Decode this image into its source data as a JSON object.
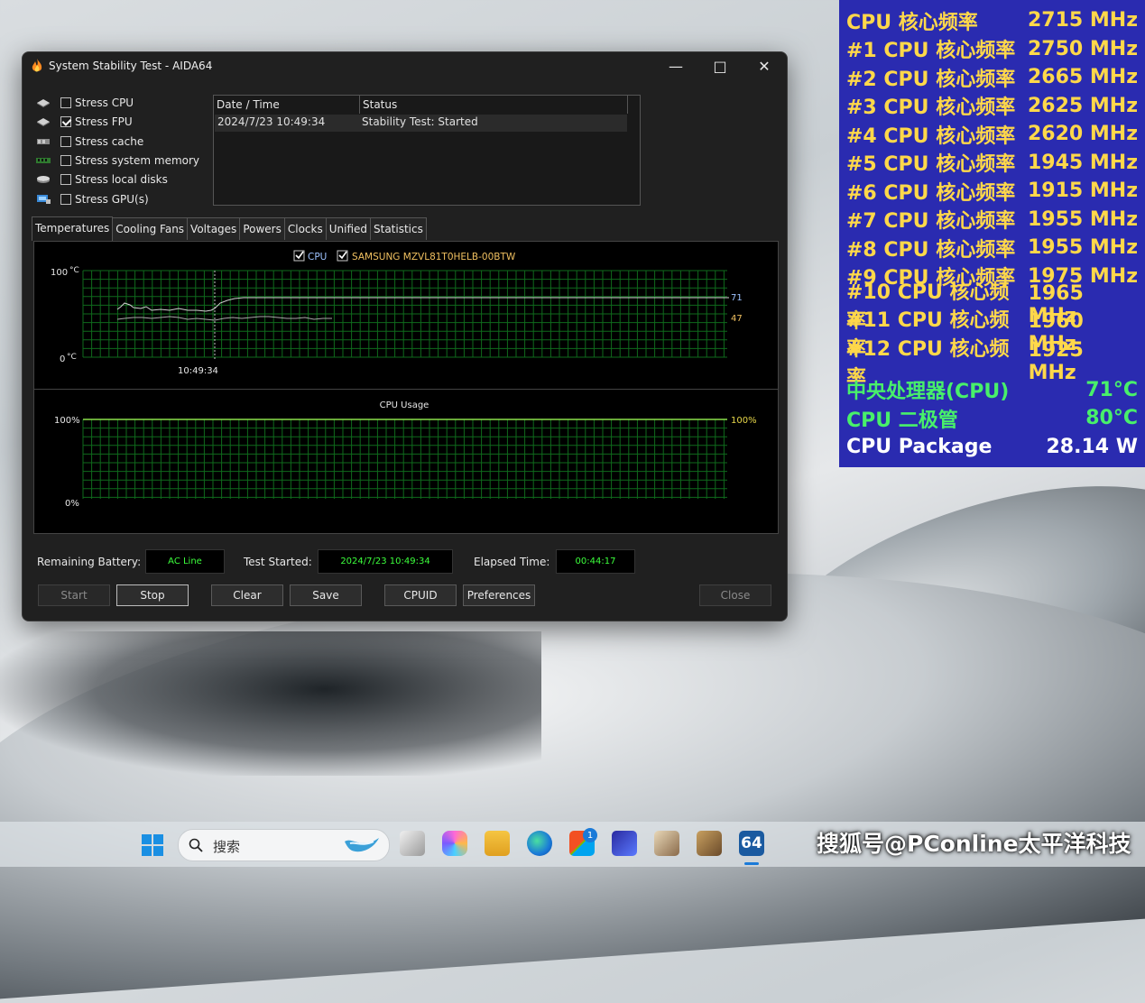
{
  "window": {
    "title": "System Stability Test - AIDA64",
    "minimize": "—",
    "maximize": "□",
    "close": "✕"
  },
  "stress_options": [
    {
      "label": "Stress CPU",
      "checked": false,
      "icon": "cpu-chip-icon"
    },
    {
      "label": "Stress FPU",
      "checked": true,
      "icon": "fpu-chip-icon"
    },
    {
      "label": "Stress cache",
      "checked": false,
      "icon": "cache-icon"
    },
    {
      "label": "Stress system memory",
      "checked": false,
      "icon": "memory-icon"
    },
    {
      "label": "Stress local disks",
      "checked": false,
      "icon": "disk-icon"
    },
    {
      "label": "Stress GPU(s)",
      "checked": false,
      "icon": "gpu-icon"
    }
  ],
  "log": {
    "headers": [
      "Date / Time",
      "Status"
    ],
    "rows": [
      [
        "2024/7/23 10:49:34",
        "Stability Test: Started"
      ]
    ]
  },
  "tabs": [
    "Temperatures",
    "Cooling Fans",
    "Voltages",
    "Powers",
    "Clocks",
    "Unified",
    "Statistics"
  ],
  "active_tab": "Temperatures",
  "temp_graph": {
    "legend": [
      {
        "label": "CPU",
        "checked": true,
        "color": "#9ec3ff"
      },
      {
        "label": "SAMSUNG MZVL81T0HELB-00BTW",
        "checked": true,
        "color": "#f0c060"
      }
    ],
    "y_top": "100",
    "y_bottom": "0",
    "unit": "°C",
    "time_label": "10:49:34",
    "value_cpu": "71",
    "value_ssd": "47"
  },
  "usage_graph": {
    "title": "CPU Usage",
    "y_top": "100%",
    "y_bottom": "0%",
    "value": "100%"
  },
  "status": {
    "battery_label": "Remaining Battery:",
    "battery_value": "AC Line",
    "started_label": "Test Started:",
    "started_value": "2024/7/23 10:49:34",
    "elapsed_label": "Elapsed Time:",
    "elapsed_value": "00:44:17"
  },
  "buttons": {
    "start": "Start",
    "stop": "Stop",
    "clear": "Clear",
    "save": "Save",
    "cpuid": "CPUID",
    "preferences": "Preferences",
    "close": "Close"
  },
  "osd": [
    {
      "label": "CPU 核心频率",
      "value": "2715 MHz",
      "color": "yellow"
    },
    {
      "label": "#1 CPU 核心频率",
      "value": "2750 MHz",
      "color": "yellow"
    },
    {
      "label": "#2 CPU 核心频率",
      "value": "2665 MHz",
      "color": "yellow"
    },
    {
      "label": "#3 CPU 核心频率",
      "value": "2625 MHz",
      "color": "yellow"
    },
    {
      "label": "#4 CPU 核心频率",
      "value": "2620 MHz",
      "color": "yellow"
    },
    {
      "label": "#5 CPU 核心频率",
      "value": "1945 MHz",
      "color": "yellow"
    },
    {
      "label": "#6 CPU 核心频率",
      "value": "1915 MHz",
      "color": "yellow"
    },
    {
      "label": "#7 CPU 核心频率",
      "value": "1955 MHz",
      "color": "yellow"
    },
    {
      "label": "#8 CPU 核心频率",
      "value": "1955 MHz",
      "color": "yellow"
    },
    {
      "label": "#9 CPU 核心频率",
      "value": "1975 MHz",
      "color": "yellow"
    },
    {
      "label": "#10 CPU 核心频率",
      "value": "1965 MHz",
      "color": "yellow"
    },
    {
      "label": "#11 CPU 核心频率",
      "value": "1960 MHz",
      "color": "yellow"
    },
    {
      "label": "#12 CPU 核心频率",
      "value": "1925 MHz",
      "color": "yellow"
    },
    {
      "label": "中央处理器(CPU)",
      "value": "71°C",
      "color": "green"
    },
    {
      "label": "CPU 二极管",
      "value": "80°C",
      "color": "green"
    },
    {
      "label": "CPU Package",
      "value": "28.14 W",
      "color": "white"
    }
  ],
  "taskbar": {
    "search_placeholder": "搜索",
    "badge": "1",
    "aida_label": "64"
  },
  "watermark": "搜狐号@PConline太平洋科技"
}
